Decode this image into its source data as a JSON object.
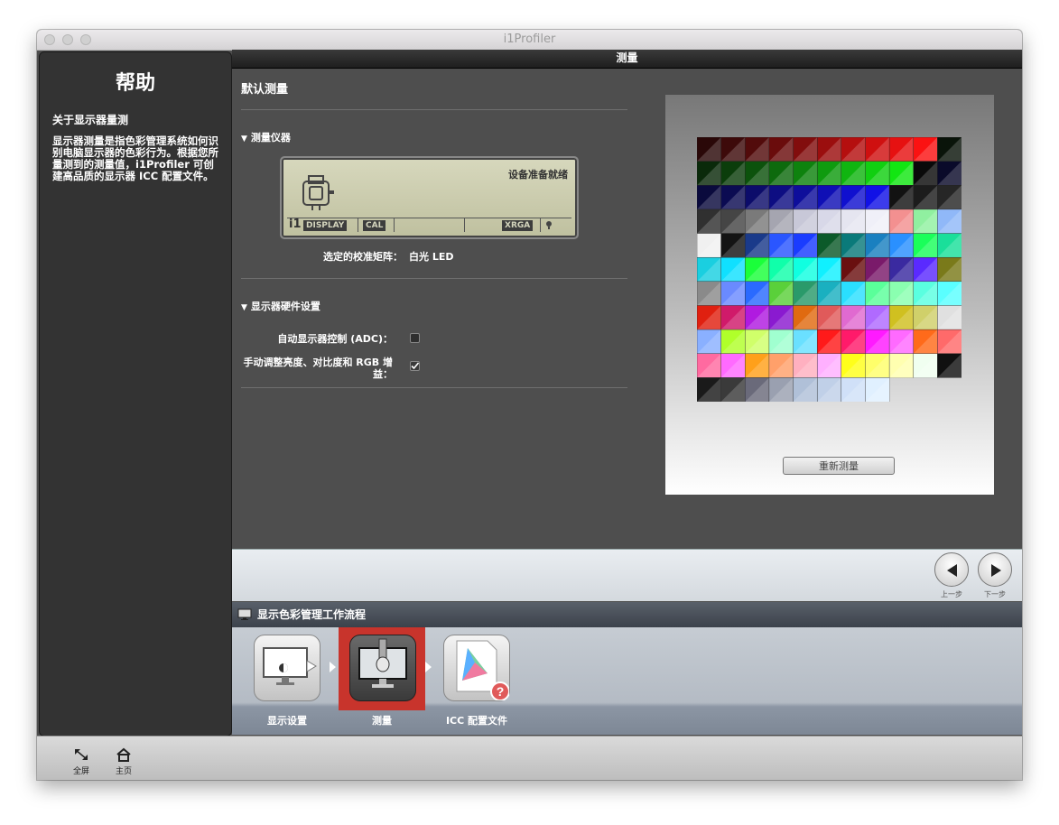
{
  "window": {
    "title": "i1Profiler"
  },
  "help": {
    "title": "帮助",
    "subtitle": "关于显示器量测",
    "body": "显示器测量是指色彩管理系统如何识别电脑显示器的色彩行为。根据您所量测到的测量值，i1Profiler 可创建高品质的显示器 ICC 配置文件。"
  },
  "main": {
    "header": "测量",
    "section_title": "默认测量",
    "instrument": {
      "heading": "测量仪器",
      "lcd_status": "设备准备就绪",
      "lcd_tags": [
        "DISPLAY",
        "CAL",
        "XRGA"
      ],
      "lcd_brand": "i1",
      "matrix_label": "选定的校准矩阵：",
      "matrix_value": "白光 LED"
    },
    "hardware": {
      "heading": "显示器硬件设置",
      "adc_label": "自动显示器控制 (ADC)：",
      "adc_checked": false,
      "manual_label_line1": "手动调整亮度、对比度和 RGB 增",
      "manual_label_line2": "益：",
      "manual_checked": true
    },
    "remeasure_button": "重新测量"
  },
  "nav": {
    "prev_label": "上一步",
    "next_label": "下一步"
  },
  "workflow": {
    "title": "显示色彩管理工作流程",
    "steps": [
      {
        "label": "显示设置",
        "selected": false
      },
      {
        "label": "测量",
        "selected": true
      },
      {
        "label": "ICC 配置文件",
        "selected": false
      }
    ]
  },
  "bottom": {
    "fullscreen_label": "全屏",
    "home_label": "主页"
  },
  "patch_grid": {
    "columns": 11,
    "rows": [
      [
        "#2a0808",
        "#3d0a0a",
        "#520b0b",
        "#6a0c0c",
        "#820d0d",
        "#9b0e0e",
        "#b50f0f",
        "#cf1010",
        "#e61111",
        "#fb1212",
        "#0a140a"
      ],
      [
        "#0a2a0a",
        "#0b3d0b",
        "#0c520c",
        "#0d6a0d",
        "#0e820e",
        "#0f9b0f",
        "#10b510",
        "#11cf11",
        "#12e612",
        "#0a0a0a",
        "#0a0a2a"
      ],
      [
        "#0a0a3d",
        "#0b0b52",
        "#0c0c6a",
        "#0d0d82",
        "#0e0e9b",
        "#0f0fb5",
        "#1010cf",
        "#1111e6",
        "#121212",
        "#1c1c1c",
        "#262626"
      ],
      [
        "#303030",
        "#454545",
        "#7a7a7a",
        "#a5a5b0",
        "#c8c8d8",
        "#d8d8e8",
        "#e5e5f0",
        "#f0f0f8",
        "#f39090",
        "#90f0a0",
        "#90b8f8"
      ],
      [
        "#f0f0f0",
        "#141414",
        "#1a3a8a",
        "#2a56ff",
        "#1a3cff",
        "#0c5a2a",
        "#0a7a7a",
        "#1a80c0",
        "#2a90ff",
        "#1aff5a",
        "#1adf9a"
      ],
      [
        "#1acfe0",
        "#10e0ff",
        "#1aff3a",
        "#10ffaa",
        "#10ffe0",
        "#10f0ff",
        "#6a1010",
        "#7a1a6a",
        "#3a2aa0",
        "#5a2aff",
        "#7a7a1a"
      ],
      [
        "#8a8a8a",
        "#6a8aff",
        "#2a6aff",
        "#5ad03a",
        "#2a9a6a",
        "#1ab0c0",
        "#2adfff",
        "#5aff9a",
        "#8affb0",
        "#5affe0",
        "#5affff"
      ],
      [
        "#e02010",
        "#d01a6a",
        "#b01ae0",
        "#8a1ad0",
        "#e06a10",
        "#e05a5a",
        "#e06ad0",
        "#b06aff",
        "#d0c020",
        "#d0d06a",
        "#e0e0e0"
      ],
      [
        "#8ab0ff",
        "#b0ff2a",
        "#d0ff6a",
        "#a0ffd0",
        "#6ae0ff",
        "#ff1a1a",
        "#ff1a6a",
        "#ff1aff",
        "#ff6aff",
        "#ff6a1a",
        "#ff6a6a"
      ],
      [
        "#ff6aa0",
        "#ff6aff",
        "#ffa01a",
        "#ffa06a",
        "#ffb0c0",
        "#ffb0ff",
        "#ffff1a",
        "#ffff6a",
        "#ffffb0",
        "#f0fff0",
        "#101010"
      ],
      [
        "#1a1a1a",
        "#3a3a3a",
        "#6a6a7a",
        "#9aa0b0",
        "#b0c0d8",
        "#c0d0e8",
        "#d0e0f8",
        "#e0f0ff",
        "",
        "",
        ""
      ]
    ]
  }
}
